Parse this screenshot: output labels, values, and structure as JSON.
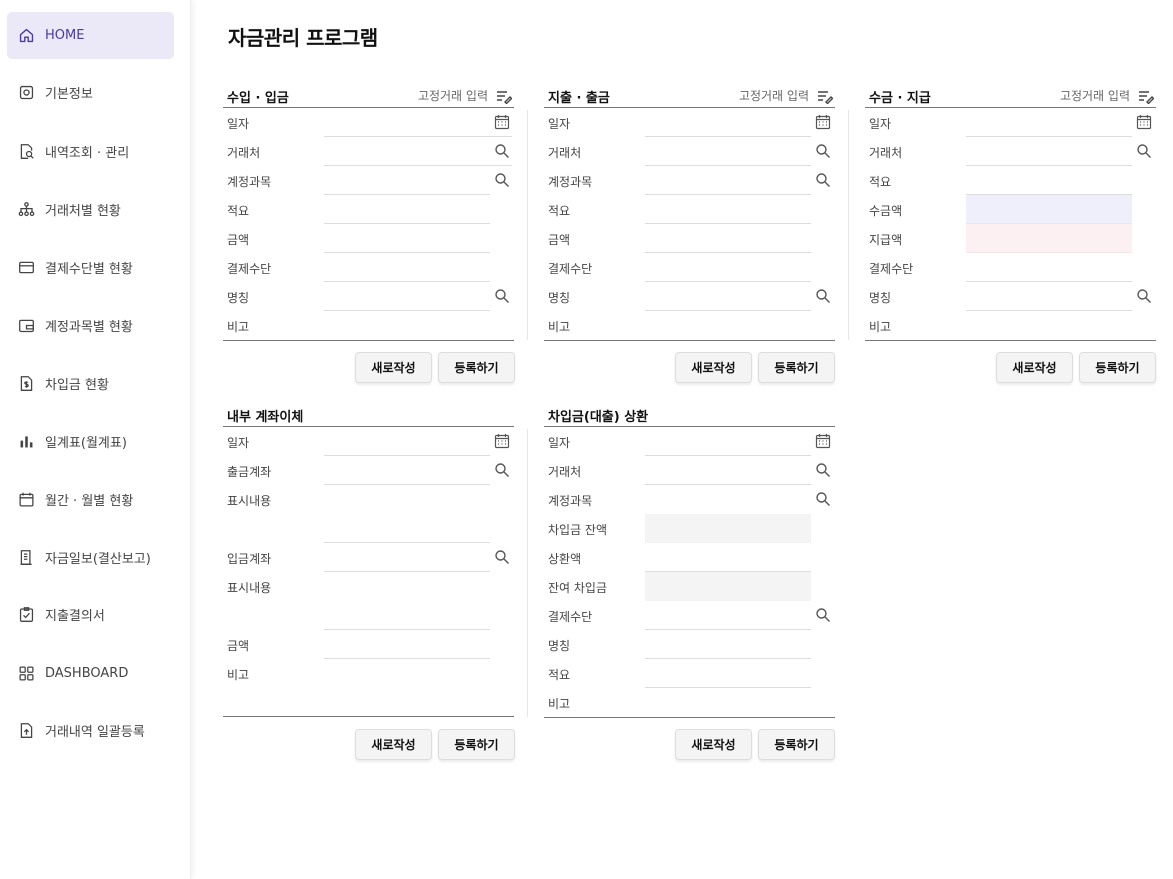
{
  "title": "자금관리 프로그램",
  "sidebar": {
    "items": [
      {
        "label": "HOME",
        "icon": "home-icon"
      },
      {
        "label": "기본정보",
        "icon": "settings-icon"
      },
      {
        "label": "내역조회 · 관리",
        "icon": "document-search-icon"
      },
      {
        "label": "거래처별 현황",
        "icon": "org-chart-icon"
      },
      {
        "label": "결제수단별 현황",
        "icon": "credit-card-icon"
      },
      {
        "label": "계정과목별 현황",
        "icon": "wallet-icon"
      },
      {
        "label": "차입금 현황",
        "icon": "document-dollar-icon"
      },
      {
        "label": "일계표(월계표)",
        "icon": "bar-chart-icon"
      },
      {
        "label": "월간 · 월별 현황",
        "icon": "calendar-icon"
      },
      {
        "label": "자금일보(결산보고)",
        "icon": "report-icon"
      },
      {
        "label": "지출결의서",
        "icon": "clipboard-check-icon"
      },
      {
        "label": "DASHBOARD",
        "icon": "grid-icon"
      },
      {
        "label": "거래내역 일괄등록",
        "icon": "file-upload-icon"
      }
    ]
  },
  "fixed_link_label": "고정거래 입력",
  "buttons": {
    "new": "새로작성",
    "register": "등록하기"
  },
  "panels": {
    "income": {
      "title": "수입 · 입금",
      "rows": [
        "일자",
        "거래처",
        "계정과목",
        "적요",
        "금액",
        "결제수단",
        "명칭",
        "비고"
      ]
    },
    "expense": {
      "title": "지출 · 출금",
      "rows": [
        "일자",
        "거래처",
        "계정과목",
        "적요",
        "금액",
        "결제수단",
        "명칭",
        "비고"
      ]
    },
    "receipt": {
      "title": "수금 · 지급",
      "rows": [
        "일자",
        "거래처",
        "적요",
        "수금액",
        "지급액",
        "결제수단",
        "명칭",
        "비고"
      ]
    },
    "transfer": {
      "title": "내부 계좌이체",
      "rows": [
        "일자",
        "출금계좌",
        "표시내용",
        "입금계좌",
        "표시내용",
        "금액",
        "비고"
      ]
    },
    "loan": {
      "title": "차입금(대출) 상환",
      "rows": [
        "일자",
        "거래처",
        "계정과목",
        "차입금 잔액",
        "상환액",
        "잔여 차입금",
        "결제수단",
        "명칭",
        "적요",
        "비고"
      ]
    }
  }
}
